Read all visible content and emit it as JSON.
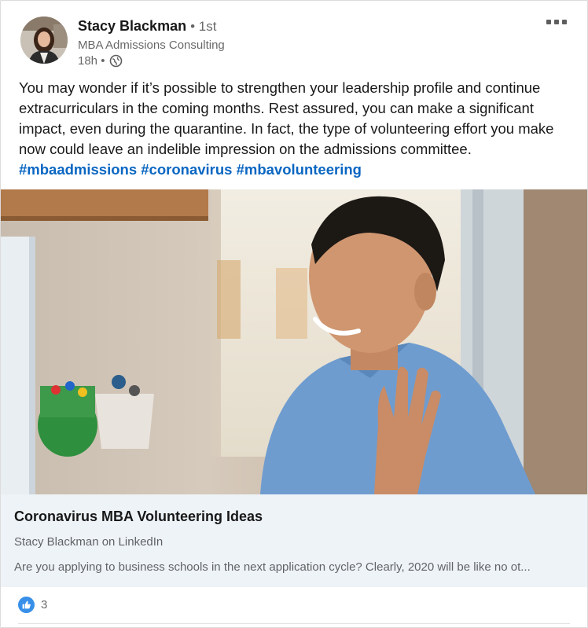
{
  "post": {
    "actor": {
      "name": "Stacy Blackman",
      "degree": "• 1st",
      "headline": "MBA Admissions Consulting",
      "time": "18h •",
      "visibility_icon": "globe-icon"
    },
    "more_icon": "ellipsis-icon",
    "commentary": "You may wonder if it’s possible to strengthen your leadership profile and continue extracurriculars in the coming months. Rest assured, you can make a significant impact, even during the quarantine. In fact, the type of volunteering effort you make now could leave an indelible impression on the admissions committee.",
    "hashtags": [
      "#mbaadmissions",
      "#coronavirus",
      "#mbavolunteering"
    ],
    "article": {
      "title": "Coronavirus MBA Volunteering Ideas",
      "source": "Stacy Blackman on LinkedIn",
      "description": "Are you applying to business schools in the next application cycle? Clearly, 2020 will be like no ot..."
    },
    "social": {
      "reaction_icon": "like-icon",
      "reaction_count": "3"
    }
  },
  "colors": {
    "link": "#0a66c2",
    "like": "#378fe9",
    "article_bg": "#eef3f8"
  }
}
